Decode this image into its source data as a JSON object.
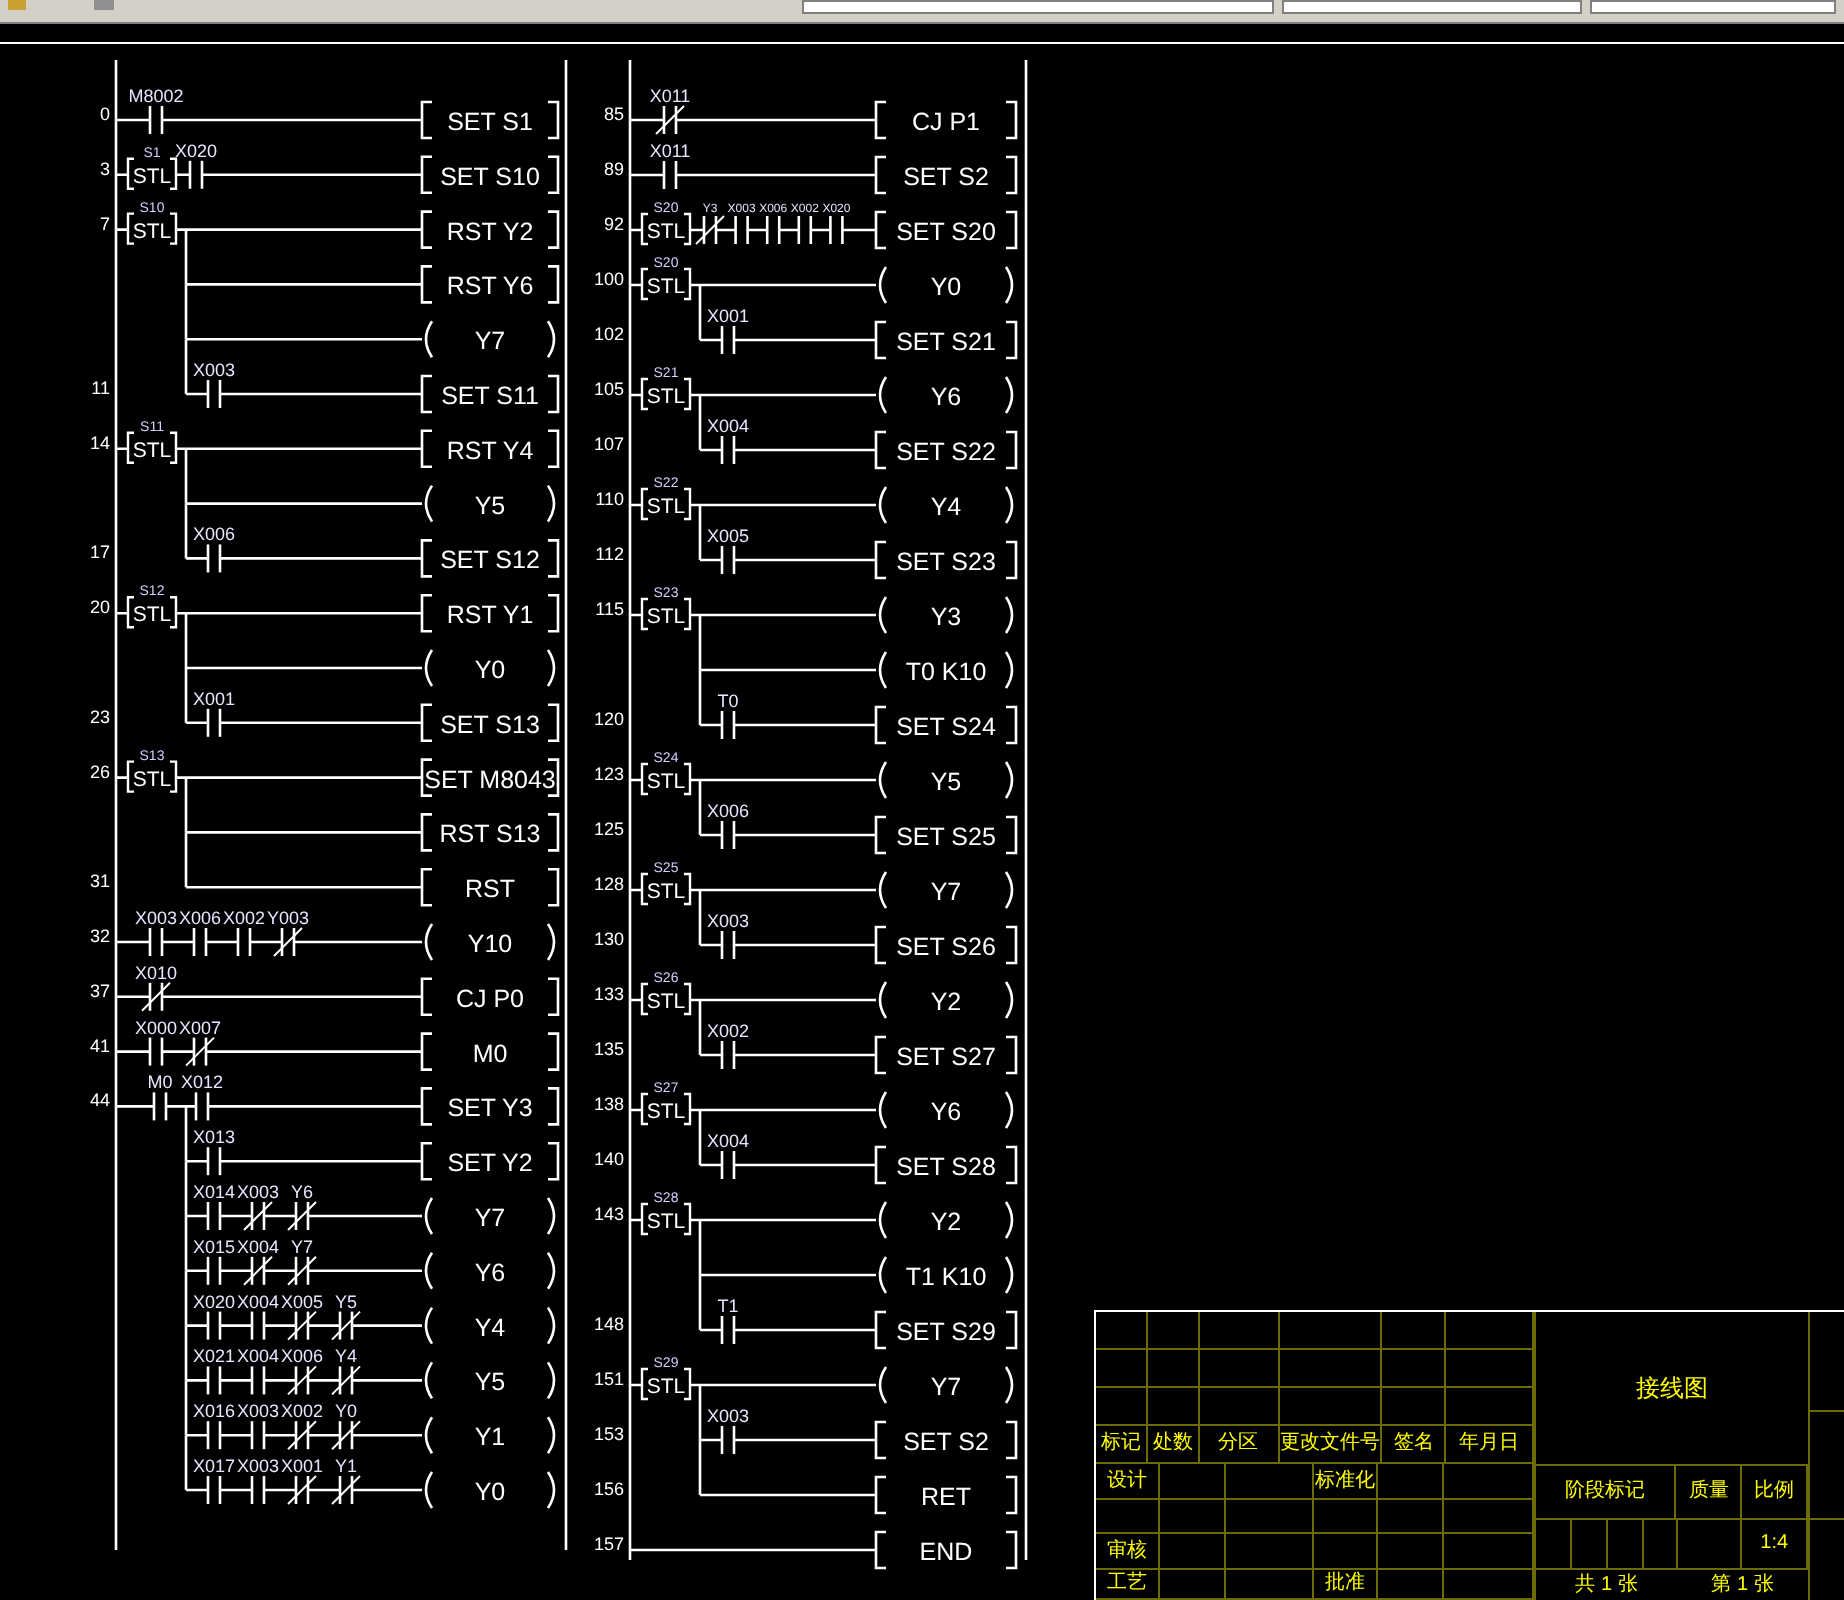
{
  "ladder": {
    "columns": [
      {
        "rungs": [
          {
            "step": "0",
            "contacts": [
              {
                "label": "M8002",
                "nc": false
              }
            ],
            "output": {
              "kind": "box",
              "text": "SET S1"
            }
          },
          {
            "step": "3",
            "head": {
              "kind": "stl",
              "text": "STL",
              "label": "S1"
            },
            "contacts": [
              {
                "label": "X020",
                "nc": false
              }
            ],
            "output": {
              "kind": "box",
              "text": "SET S10"
            }
          },
          {
            "step": "7",
            "head": {
              "kind": "stl",
              "text": "STL",
              "label": "S10"
            },
            "output": {
              "kind": "box",
              "text": "RST Y2"
            }
          },
          {
            "branch": true,
            "output": {
              "kind": "box",
              "text": "RST Y6"
            }
          },
          {
            "branch": true,
            "output": {
              "kind": "coil",
              "text": "Y7"
            }
          },
          {
            "step": "11",
            "branch": true,
            "contacts": [
              {
                "label": "X003",
                "nc": false
              }
            ],
            "output": {
              "kind": "box",
              "text": "SET S11"
            }
          },
          {
            "step": "14",
            "head": {
              "kind": "stl",
              "text": "STL",
              "label": "S11"
            },
            "output": {
              "kind": "box",
              "text": "RST Y4"
            }
          },
          {
            "branch": true,
            "output": {
              "kind": "coil",
              "text": "Y5"
            }
          },
          {
            "step": "17",
            "branch": true,
            "contacts": [
              {
                "label": "X006",
                "nc": false
              }
            ],
            "output": {
              "kind": "box",
              "text": "SET S12"
            }
          },
          {
            "step": "20",
            "head": {
              "kind": "stl",
              "text": "STL",
              "label": "S12"
            },
            "output": {
              "kind": "box",
              "text": "RST Y1"
            }
          },
          {
            "branch": true,
            "output": {
              "kind": "coil",
              "text": "Y0"
            }
          },
          {
            "step": "23",
            "branch": true,
            "contacts": [
              {
                "label": "X001",
                "nc": false
              }
            ],
            "output": {
              "kind": "box",
              "text": "SET S13"
            }
          },
          {
            "step": "26",
            "head": {
              "kind": "stl",
              "text": "STL",
              "label": "S13"
            },
            "output": {
              "kind": "box",
              "text": "SET M8043"
            }
          },
          {
            "branch": true,
            "output": {
              "kind": "box",
              "text": "RST S13"
            }
          },
          {
            "step": "31",
            "branch": true,
            "output": {
              "kind": "box",
              "text": "RST"
            }
          },
          {
            "step": "32",
            "contacts": [
              {
                "label": "X003",
                "nc": false
              },
              {
                "label": "X006",
                "nc": false
              },
              {
                "label": "X002",
                "nc": false
              },
              {
                "label": "Y003",
                "nc": true
              }
            ],
            "output": {
              "kind": "coil",
              "text": "Y10"
            }
          },
          {
            "step": "37",
            "contacts": [
              {
                "label": "X010",
                "nc": true
              }
            ],
            "output": {
              "kind": "box",
              "text": "CJ P0"
            }
          },
          {
            "step": "41",
            "contacts": [
              {
                "label": "X000",
                "nc": false
              },
              {
                "label": "X007",
                "nc": true
              }
            ],
            "output": {
              "kind": "box",
              "text": "M0"
            }
          },
          {
            "step": "44",
            "head": {
              "kind": "contact",
              "label": "M0",
              "nc": false
            },
            "contacts": [
              {
                "label": "X012",
                "nc": false
              }
            ],
            "output": {
              "kind": "box",
              "text": "SET Y3"
            }
          },
          {
            "branch": true,
            "contacts": [
              {
                "label": "X013",
                "nc": false
              }
            ],
            "output": {
              "kind": "box",
              "text": "SET Y2"
            }
          },
          {
            "branch": true,
            "contacts": [
              {
                "label": "X014",
                "nc": false
              },
              {
                "label": "X003",
                "nc": true
              },
              {
                "label": "Y6",
                "nc": true
              }
            ],
            "output": {
              "kind": "coil",
              "text": "Y7"
            }
          },
          {
            "branch": true,
            "contacts": [
              {
                "label": "X015",
                "nc": false
              },
              {
                "label": "X004",
                "nc": true
              },
              {
                "label": "Y7",
                "nc": true
              }
            ],
            "output": {
              "kind": "coil",
              "text": "Y6"
            }
          },
          {
            "branch": true,
            "contacts": [
              {
                "label": "X020",
                "nc": false
              },
              {
                "label": "X004",
                "nc": false
              },
              {
                "label": "X005",
                "nc": true
              },
              {
                "label": "Y5",
                "nc": true
              }
            ],
            "output": {
              "kind": "coil",
              "text": "Y4"
            }
          },
          {
            "branch": true,
            "contacts": [
              {
                "label": "X021",
                "nc": false
              },
              {
                "label": "X004",
                "nc": false
              },
              {
                "label": "X006",
                "nc": true
              },
              {
                "label": "Y4",
                "nc": true
              }
            ],
            "output": {
              "kind": "coil",
              "text": "Y5"
            }
          },
          {
            "branch": true,
            "contacts": [
              {
                "label": "X016",
                "nc": false
              },
              {
                "label": "X003",
                "nc": false
              },
              {
                "label": "X002",
                "nc": true
              },
              {
                "label": "Y0",
                "nc": true
              }
            ],
            "output": {
              "kind": "coil",
              "text": "Y1"
            }
          },
          {
            "branch": true,
            "contacts": [
              {
                "label": "X017",
                "nc": false
              },
              {
                "label": "X003",
                "nc": false
              },
              {
                "label": "X001",
                "nc": true
              },
              {
                "label": "Y1",
                "nc": true
              }
            ],
            "output": {
              "kind": "coil",
              "text": "Y0"
            }
          }
        ]
      },
      {
        "rungs": [
          {
            "step": "85",
            "contacts": [
              {
                "label": "X011",
                "nc": true
              }
            ],
            "output": {
              "kind": "box",
              "text": "CJ P1"
            }
          },
          {
            "step": "89",
            "contacts": [
              {
                "label": "X011",
                "nc": false
              }
            ],
            "output": {
              "kind": "box",
              "text": "SET S2"
            }
          },
          {
            "step": "92",
            "head": {
              "kind": "stl",
              "text": "STL",
              "label": "S20"
            },
            "contacts": [
              {
                "label": "Y3",
                "nc": true
              },
              {
                "label": "X003",
                "nc": false
              },
              {
                "label": "X006",
                "nc": false
              },
              {
                "label": "X002",
                "nc": false
              },
              {
                "label": "X020",
                "nc": false
              }
            ],
            "output": {
              "kind": "box",
              "text": "SET S20"
            }
          },
          {
            "step": "100",
            "head": {
              "kind": "stl",
              "text": "STL",
              "label": "S20"
            },
            "output": {
              "kind": "coil",
              "text": "Y0"
            }
          },
          {
            "step": "102",
            "branch": true,
            "contacts": [
              {
                "label": "X001",
                "nc": false
              }
            ],
            "output": {
              "kind": "box",
              "text": "SET S21"
            }
          },
          {
            "step": "105",
            "head": {
              "kind": "stl",
              "text": "STL",
              "label": "S21"
            },
            "output": {
              "kind": "coil",
              "text": "Y6"
            }
          },
          {
            "step": "107",
            "branch": true,
            "contacts": [
              {
                "label": "X004",
                "nc": false
              }
            ],
            "output": {
              "kind": "box",
              "text": "SET S22"
            }
          },
          {
            "step": "110",
            "head": {
              "kind": "stl",
              "text": "STL",
              "label": "S22"
            },
            "output": {
              "kind": "coil",
              "text": "Y4"
            }
          },
          {
            "step": "112",
            "branch": true,
            "contacts": [
              {
                "label": "X005",
                "nc": false
              }
            ],
            "output": {
              "kind": "box",
              "text": "SET S23"
            }
          },
          {
            "step": "115",
            "head": {
              "kind": "stl",
              "text": "STL",
              "label": "S23"
            },
            "output": {
              "kind": "coil",
              "text": "Y3"
            }
          },
          {
            "branch": true,
            "output": {
              "kind": "coil",
              "text": "T0 K10"
            }
          },
          {
            "step": "120",
            "branch": true,
            "contacts": [
              {
                "label": "T0",
                "nc": false
              }
            ],
            "output": {
              "kind": "box",
              "text": "SET S24"
            }
          },
          {
            "step": "123",
            "head": {
              "kind": "stl",
              "text": "STL",
              "label": "S24"
            },
            "output": {
              "kind": "coil",
              "text": "Y5"
            }
          },
          {
            "step": "125",
            "branch": true,
            "contacts": [
              {
                "label": "X006",
                "nc": false
              }
            ],
            "output": {
              "kind": "box",
              "text": "SET S25"
            }
          },
          {
            "step": "128",
            "head": {
              "kind": "stl",
              "text": "STL",
              "label": "S25"
            },
            "output": {
              "kind": "coil",
              "text": "Y7"
            }
          },
          {
            "step": "130",
            "branch": true,
            "contacts": [
              {
                "label": "X003",
                "nc": false
              }
            ],
            "output": {
              "kind": "box",
              "text": "SET S26"
            }
          },
          {
            "step": "133",
            "head": {
              "kind": "stl",
              "text": "STL",
              "label": "S26"
            },
            "output": {
              "kind": "coil",
              "text": "Y2"
            }
          },
          {
            "step": "135",
            "branch": true,
            "contacts": [
              {
                "label": "X002",
                "nc": false
              }
            ],
            "output": {
              "kind": "box",
              "text": "SET S27"
            }
          },
          {
            "step": "138",
            "head": {
              "kind": "stl",
              "text": "STL",
              "label": "S27"
            },
            "output": {
              "kind": "coil",
              "text": "Y6"
            }
          },
          {
            "step": "140",
            "branch": true,
            "contacts": [
              {
                "label": "X004",
                "nc": false
              }
            ],
            "output": {
              "kind": "box",
              "text": "SET S28"
            }
          },
          {
            "step": "143",
            "head": {
              "kind": "stl",
              "text": "STL",
              "label": "S28"
            },
            "output": {
              "kind": "coil",
              "text": "Y2"
            }
          },
          {
            "branch": true,
            "output": {
              "kind": "coil",
              "text": "T1 K10"
            }
          },
          {
            "step": "148",
            "branch": true,
            "contacts": [
              {
                "label": "T1",
                "nc": false
              }
            ],
            "output": {
              "kind": "box",
              "text": "SET S29"
            }
          },
          {
            "step": "151",
            "head": {
              "kind": "stl",
              "text": "STL",
              "label": "S29"
            },
            "output": {
              "kind": "coil",
              "text": "Y7"
            }
          },
          {
            "step": "153",
            "branch": true,
            "contacts": [
              {
                "label": "X003",
                "nc": false
              }
            ],
            "output": {
              "kind": "box",
              "text": "SET S2"
            }
          },
          {
            "step": "156",
            "branch": true,
            "output": {
              "kind": "box",
              "text": "RET"
            }
          },
          {
            "step": "157",
            "output": {
              "kind": "box",
              "text": "END"
            }
          }
        ]
      }
    ]
  },
  "title_block": {
    "title": "接线图",
    "revision_headers": [
      "标记",
      "处数",
      "分区",
      "更改文件号",
      "签名",
      "年月日"
    ],
    "approvals": [
      {
        "role": "设计",
        "second_role": "标准化"
      },
      {
        "role": "审核"
      },
      {
        "role": "工艺",
        "second_role": "批准"
      }
    ],
    "stage_headers": [
      "阶段标记",
      "质量",
      "比例"
    ],
    "scale": "1:4",
    "sheet_total": "共 1 张",
    "sheet_number": "第 1 张"
  }
}
